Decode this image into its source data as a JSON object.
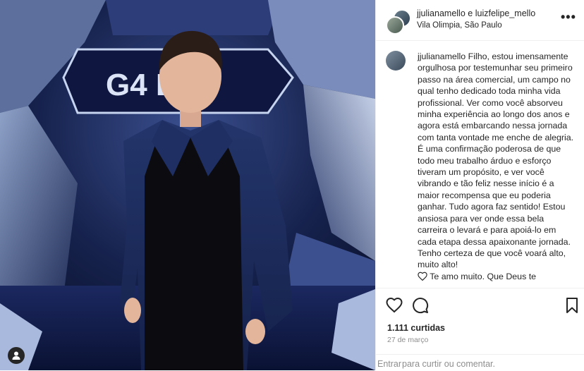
{
  "post": {
    "photo_alt": "photo",
    "logo_text": "G4 DAY",
    "user_tag_icon": "person-icon"
  },
  "header": {
    "author1": "jjulianamello",
    "joiner": "e",
    "author2": "luizfelipe_mello",
    "location": "Vila Olimpia, São Paulo",
    "more_icon": "•••"
  },
  "caption": {
    "username": "jjulianamello",
    "text": "Filho, estou imensamente orgulhosa por testemunhar seu primeiro passo na área comercial, um campo no qual tenho dedicado toda minha vida profissional. Ver como você absorveu minha experiência ao longo dos anos e agora está embarcando nessa jornada com tanta vontade me enche de alegria. É uma confirmação poderosa de que todo meu trabalho árduo e esforço tiveram um propósito, e ver você vibrando e tão feliz nesse início é a maior recompensa que eu poderia ganhar. Tudo agora faz sentido! Estou ansiosa para ver onde essa bela carreira o levará e para apoiá-lo em cada etapa dessa apaixonante jornada. Tenho certeza de que você voará alto, muito alto!",
    "last_line": "Te amo muito. Que Deus te"
  },
  "stats": {
    "likes": "1.111 curtidas",
    "date": "27 de março"
  },
  "comment": {
    "enter": "Entrar",
    "rest": "para curtir ou comentar."
  },
  "colors": {
    "text": "#262626",
    "muted": "#8e8e8e",
    "border": "#efefef"
  }
}
